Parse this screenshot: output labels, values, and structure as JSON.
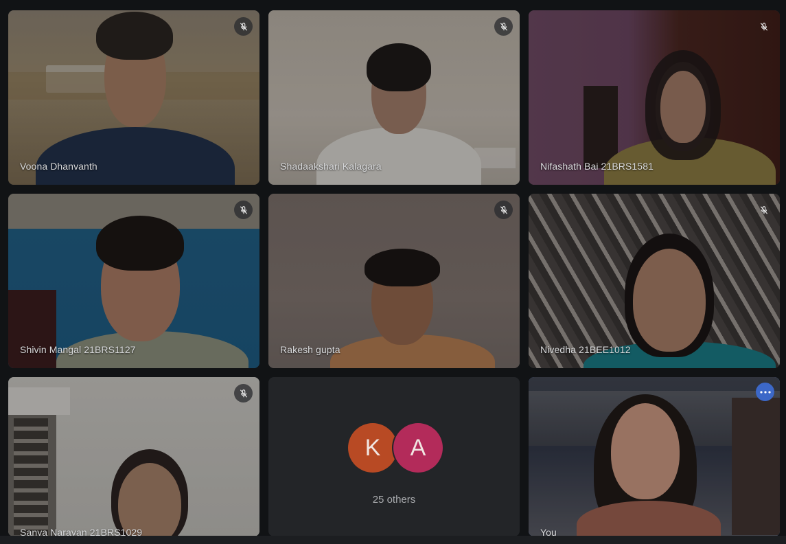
{
  "participants": [
    {
      "name": "Voona Dhanvanth",
      "muted": true
    },
    {
      "name": "Shadaakshari Kalagara",
      "muted": true
    },
    {
      "name": "Nifashath Bai 21BRS1581",
      "muted": true
    },
    {
      "name": "Shivin Mangal 21BRS1127",
      "muted": true
    },
    {
      "name": "Rakesh gupta",
      "muted": true
    },
    {
      "name": "Nivedha 21BEE1012",
      "muted": true
    },
    {
      "name": "Sanya Narayan 21BRS1029",
      "muted": true
    }
  ],
  "others": {
    "avatars": [
      {
        "initial": "K",
        "color": "#b84a24"
      },
      {
        "initial": "A",
        "color": "#b32b5a"
      }
    ],
    "label": "25 others"
  },
  "self": {
    "name": "You",
    "highlight_color": "#4f7ed6"
  },
  "icons": {
    "mute": "mic-off-icon",
    "more": "more-options-icon"
  }
}
